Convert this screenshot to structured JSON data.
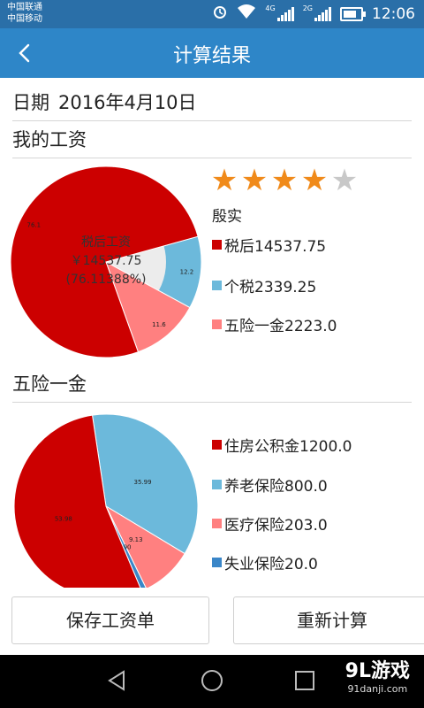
{
  "status": {
    "carrier1": "中国联通",
    "carrier2": "中国移动",
    "net1": "4G",
    "net2": "2G",
    "time": "12:06"
  },
  "header": {
    "title": "计算结果"
  },
  "date": {
    "label": "日期",
    "value": "2016年4月10日"
  },
  "salary": {
    "section_title": "我的工资",
    "center_line1": "税后工资",
    "center_line2": "￥14537.75",
    "center_line3": "(76.11388%)",
    "rating_stars": 4,
    "rating_max": 5,
    "rating_text": "殷实",
    "legend": [
      {
        "text": "税后14537.75",
        "color": "#cc0000"
      },
      {
        "text": "个税2339.25",
        "color": "#6cb9db"
      },
      {
        "text": "五险一金2223.0",
        "color": "#ff8080"
      }
    ]
  },
  "wxyj": {
    "section_title": "五险一金",
    "legend": [
      {
        "text": "住房公积金1200.0",
        "color": "#cc0000"
      },
      {
        "text": "养老保险800.0",
        "color": "#6cb9db"
      },
      {
        "text": "医疗保险203.0",
        "color": "#ff8080"
      },
      {
        "text": "失业保险20.0",
        "color": "#3a86c8"
      }
    ]
  },
  "chart_data": [
    {
      "type": "pie",
      "categories": [
        "税后",
        "个税",
        "五险一金"
      ],
      "values": [
        76.1,
        12.2,
        11.6
      ],
      "labels": [
        "76.1",
        "12.2",
        "11.6"
      ],
      "colors": [
        "#cc0000",
        "#6cb9db",
        "#ff8080"
      ],
      "donut": true
    },
    {
      "type": "pie",
      "categories": [
        "住房公积金",
        "养老保险",
        "医疗保险",
        "失业保险"
      ],
      "values": [
        53.98,
        35.99,
        9.13,
        0.9
      ],
      "labels": [
        "53.98",
        "35.99",
        "9.13",
        "0.90"
      ],
      "colors": [
        "#cc0000",
        "#6cb9db",
        "#ff8080",
        "#3a86c8"
      ],
      "donut": false
    }
  ],
  "buttons": {
    "save": "保存工资单",
    "recalc": "重新计算"
  },
  "brand": {
    "line1": "9L游戏",
    "line2": "91danji.com"
  }
}
